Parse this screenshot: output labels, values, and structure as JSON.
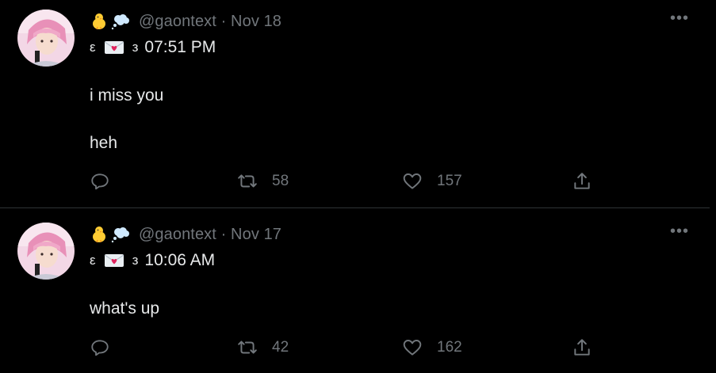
{
  "tweets": [
    {
      "handle": "@gaontext",
      "separator": "·",
      "date": "Nov 18",
      "bracket_left": "ε",
      "bracket_right": "з",
      "time": "07:51 PM",
      "lines": [
        "i miss you",
        "heh"
      ],
      "retweets": "58",
      "likes": "157",
      "more": "•••"
    },
    {
      "handle": "@gaontext",
      "separator": "·",
      "date": "Nov 17",
      "bracket_left": "ε",
      "bracket_right": "з",
      "time": "10:06 AM",
      "lines": [
        "what's up"
      ],
      "retweets": "42",
      "likes": "162",
      "more": "•••"
    }
  ],
  "icons": {
    "chick": "baby-chick-icon",
    "bubble": "thought-balloon-icon",
    "envelope": "love-letter-icon",
    "reply": "reply-icon",
    "retweet": "retweet-icon",
    "like": "heart-icon",
    "share": "share-icon"
  },
  "colors": {
    "background": "#000000",
    "text": "#e7e9ea",
    "muted": "#71767b",
    "divider": "#2f3336"
  }
}
